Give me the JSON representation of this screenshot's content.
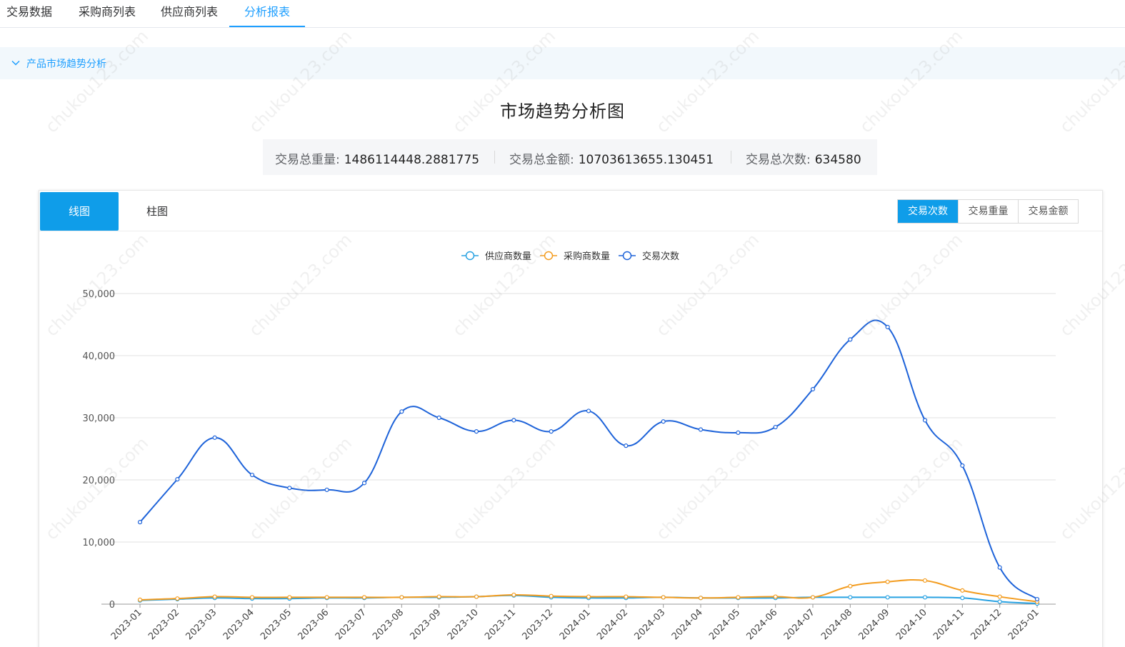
{
  "tabs": {
    "t1": "交易数据",
    "t2": "采购商列表",
    "t3": "供应商列表",
    "t4": "分析报表"
  },
  "collapse": {
    "title": "产品市场趋势分析"
  },
  "page": {
    "title": "市场趋势分析图"
  },
  "summary": {
    "weight_label": "交易总重量:",
    "weight_value": "1486114448.2881775",
    "amount_label": "交易总金额:",
    "amount_value": "10703613655.130451",
    "count_label": "交易总次数:",
    "count_value": "634580"
  },
  "chart_tabs": {
    "line": "线图",
    "bar": "柱图"
  },
  "metrics": {
    "count": "交易次数",
    "weight": "交易重量",
    "amount": "交易金额"
  },
  "watermark": "chukou123.com",
  "colors": {
    "accent": "#1e9fff",
    "supplier": "#29a2e2",
    "buyer": "#f39c1f",
    "trades": "#1e63d9"
  },
  "chart_data": {
    "type": "line",
    "title": "",
    "xlabel": "",
    "ylabel": "",
    "ylim": [
      0,
      50000
    ],
    "yticks": [
      0,
      10000,
      20000,
      30000,
      40000,
      50000
    ],
    "ytick_labels": [
      "0",
      "10,000",
      "20,000",
      "30,000",
      "40,000",
      "50,000"
    ],
    "grid": true,
    "legend_position": "top-center",
    "categories": [
      "2023-01",
      "2023-02",
      "2023-03",
      "2023-04",
      "2023-05",
      "2023-06",
      "2023-07",
      "2023-08",
      "2023-09",
      "2023-10",
      "2023-11",
      "2023-12",
      "2024-01",
      "2024-02",
      "2024-03",
      "2024-04",
      "2024-05",
      "2024-06",
      "2024-07",
      "2024-08",
      "2024-09",
      "2024-10",
      "2024-11",
      "2024-12",
      "2025-01"
    ],
    "series": [
      {
        "name": "供应商数量",
        "color": "#29a2e2",
        "values": [
          600,
          800,
          1000,
          900,
          900,
          1000,
          1000,
          1100,
          1100,
          1200,
          1400,
          1100,
          1000,
          1000,
          1100,
          1000,
          1000,
          1000,
          1100,
          1100,
          1100,
          1100,
          1000,
          400,
          100
        ]
      },
      {
        "name": "采购商数量",
        "color": "#f39c1f",
        "values": [
          700,
          900,
          1200,
          1100,
          1100,
          1100,
          1100,
          1100,
          1200,
          1200,
          1500,
          1300,
          1200,
          1200,
          1100,
          1000,
          1100,
          1200,
          1100,
          2900,
          3600,
          3800,
          2200,
          1200,
          400
        ]
      },
      {
        "name": "交易次数",
        "color": "#1e63d9",
        "values": [
          13200,
          20100,
          26800,
          20800,
          18700,
          18400,
          19500,
          31000,
          30000,
          27800,
          29600,
          27800,
          31100,
          25500,
          29400,
          28100,
          27600,
          28500,
          34600,
          42600,
          44600,
          29600,
          22300,
          5900,
          800
        ]
      }
    ]
  }
}
